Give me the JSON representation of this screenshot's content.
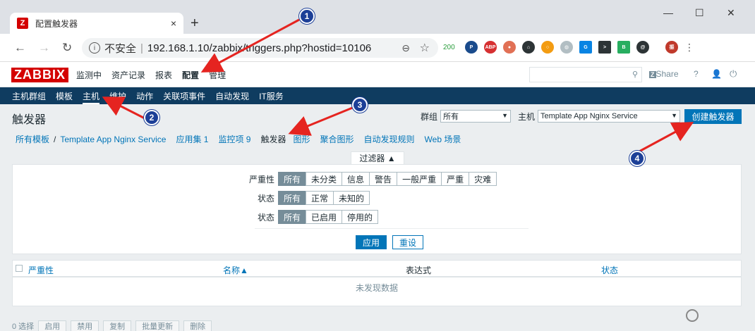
{
  "browser": {
    "tab_title": "配置触发器",
    "tab_close": "×",
    "new_tab": "+",
    "url_prefix": "不安全",
    "url_host": "192.168.1.10/zabbix/triggers.php?hostid=10106",
    "ext_badge": "200"
  },
  "zabbix": {
    "logo": "ZABBIX",
    "top_menu": [
      "监测中",
      "资产记录",
      "报表",
      "配置",
      "管理"
    ],
    "share": "Share",
    "help": "?",
    "sub_menu": [
      "主机群组",
      "模板",
      "主机",
      "维护",
      "动作",
      "关联项事件",
      "自动发现",
      "IT服务"
    ],
    "page_title": "触发器",
    "group_label": "群组",
    "group_value": "所有",
    "host_label": "主机",
    "host_value": "Template App Nginx Service",
    "create_button": "创建触发器",
    "breadcrumbs": {
      "all_templates": "所有模板",
      "separator": "/",
      "template": "Template App Nginx Service",
      "apps": "应用集 1",
      "items": "监控项 9",
      "triggers": "触发器",
      "graphs": "图形",
      "screens": "聚合图形",
      "discovery": "自动发现规则",
      "web": "Web 场景"
    },
    "filter": {
      "tab": "过滤器 ▲",
      "severity_label": "严重性",
      "severity_options": [
        "所有",
        "未分类",
        "信息",
        "警告",
        "一般严重",
        "严重",
        "灾难"
      ],
      "state_label": "状态",
      "state_options": [
        "所有",
        "正常",
        "未知的"
      ],
      "status_label": "状态",
      "status_options": [
        "所有",
        "已启用",
        "停用的"
      ],
      "apply": "应用",
      "reset": "重设"
    },
    "table": {
      "columns": [
        "严重性",
        "名称▲",
        "表达式",
        "状态"
      ],
      "empty": "未发现数据"
    },
    "footer_actions": [
      "0 选择",
      "启用",
      "禁用",
      "复制",
      "批量更新",
      "删除"
    ]
  },
  "annotations": [
    "1",
    "2",
    "3",
    "4"
  ],
  "colors": {
    "zabbix_red": "#d40000",
    "nav_blue": "#0f3c60",
    "button_blue": "#0275b8",
    "arrow_red": "#e52420",
    "badge_blue": "#1c3f97"
  }
}
